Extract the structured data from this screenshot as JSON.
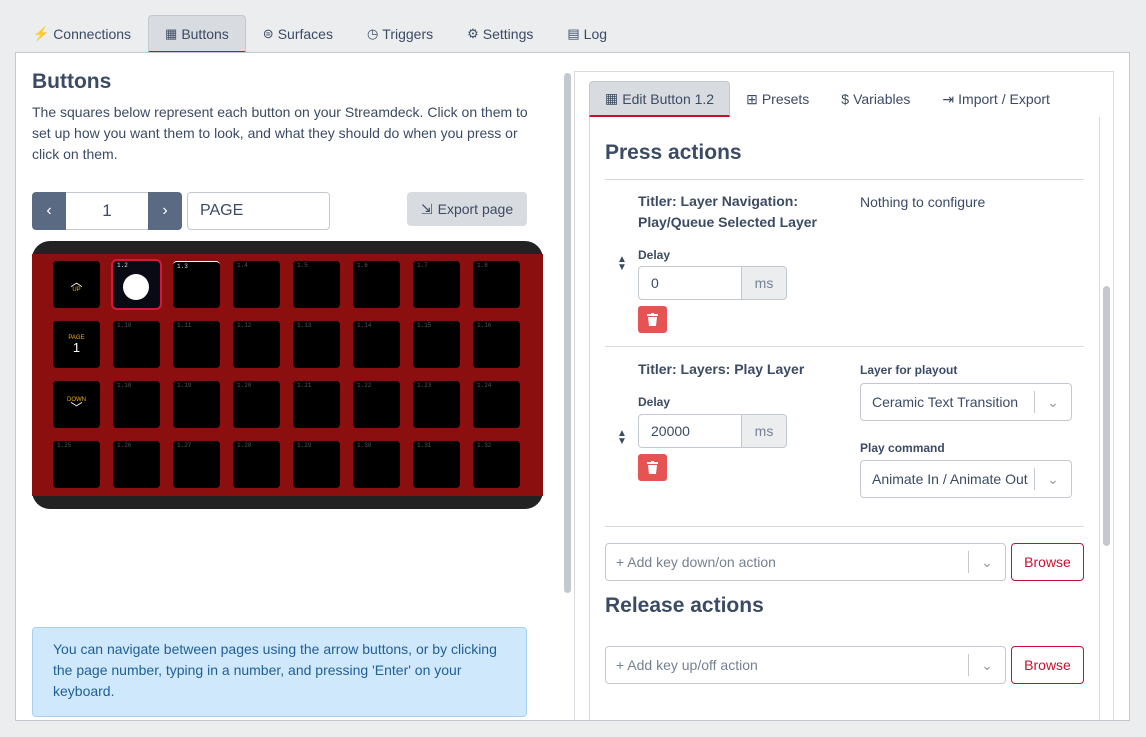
{
  "top_tabs": [
    {
      "label": "Connections",
      "icon": "plug-icon",
      "glyph": "⚡"
    },
    {
      "label": "Buttons",
      "icon": "calendar-grid-icon",
      "glyph": "▦"
    },
    {
      "label": "Surfaces",
      "icon": "gamepad-icon",
      "glyph": "🎮"
    },
    {
      "label": "Triggers",
      "icon": "clock-icon",
      "glyph": "◷"
    },
    {
      "label": "Settings",
      "icon": "user-cog-icon",
      "glyph": "⚙"
    },
    {
      "label": "Log",
      "icon": "clipboard-icon",
      "glyph": "📋"
    }
  ],
  "buttons_panel": {
    "title": "Buttons",
    "intro": "The squares below represent each button on your Streamdeck. Click on them to set up how you want them to look, and what they should do when you press or click on them.",
    "page_number": "1",
    "page_name": "PAGE",
    "export_label": "Export page",
    "info": "You can navigate between pages using the arrow buttons, or by clicking the page number, typing in a number, and pressing 'Enter' on your keyboard."
  },
  "deck": {
    "selected": "1.2",
    "nav": {
      "up": "UP",
      "page": "PAGE",
      "page_num": "1",
      "down": "DOWN"
    },
    "key_labels": [
      "",
      "1.2",
      "1.3",
      "1.4",
      "1.5",
      "1.6",
      "1.7",
      "1.8",
      "",
      "1.10",
      "1.11",
      "1.12",
      "1.13",
      "1.14",
      "1.15",
      "1.16",
      "",
      "1.18",
      "1.19",
      "1.20",
      "1.21",
      "1.22",
      "1.23",
      "1.24",
      "1.25",
      "1.26",
      "1.27",
      "1.28",
      "1.29",
      "1.30",
      "1.31",
      "1.32"
    ]
  },
  "right_tabs": [
    {
      "label": "Edit Button 1.2",
      "icon": "calculator-icon",
      "glyph": "▦"
    },
    {
      "label": "Presets",
      "icon": "gift-icon",
      "glyph": "🎁"
    },
    {
      "label": "Variables",
      "icon": "dollar-icon",
      "glyph": "$"
    },
    {
      "label": "Import / Export",
      "icon": "file-import-icon",
      "glyph": "⇥"
    }
  ],
  "editor": {
    "press_title": "Press actions",
    "action1": {
      "title_line1": "Titler: Layer Navigation:",
      "title_line2": "Play/Queue Selected Layer",
      "config": "Nothing to configure",
      "delay_label": "Delay",
      "delay": "0",
      "unit": "ms"
    },
    "action2": {
      "title": "Titler: Layers: Play Layer",
      "delay_label": "Delay",
      "delay": "20000",
      "unit": "ms",
      "layer_label": "Layer for playout",
      "layer_value": "Ceramic Text Transition",
      "play_label": "Play command",
      "play_value": "Animate In / Animate Out"
    },
    "add_down_placeholder": "+ Add key down/on action",
    "browse": "Browse",
    "release_title": "Release actions",
    "add_up_placeholder": "+ Add key up/off action"
  },
  "colors": {
    "accent": "#c8102e",
    "deck_red": "#8b0f0f",
    "danger": "#e55353",
    "info_bg": "#d0e8fb"
  }
}
